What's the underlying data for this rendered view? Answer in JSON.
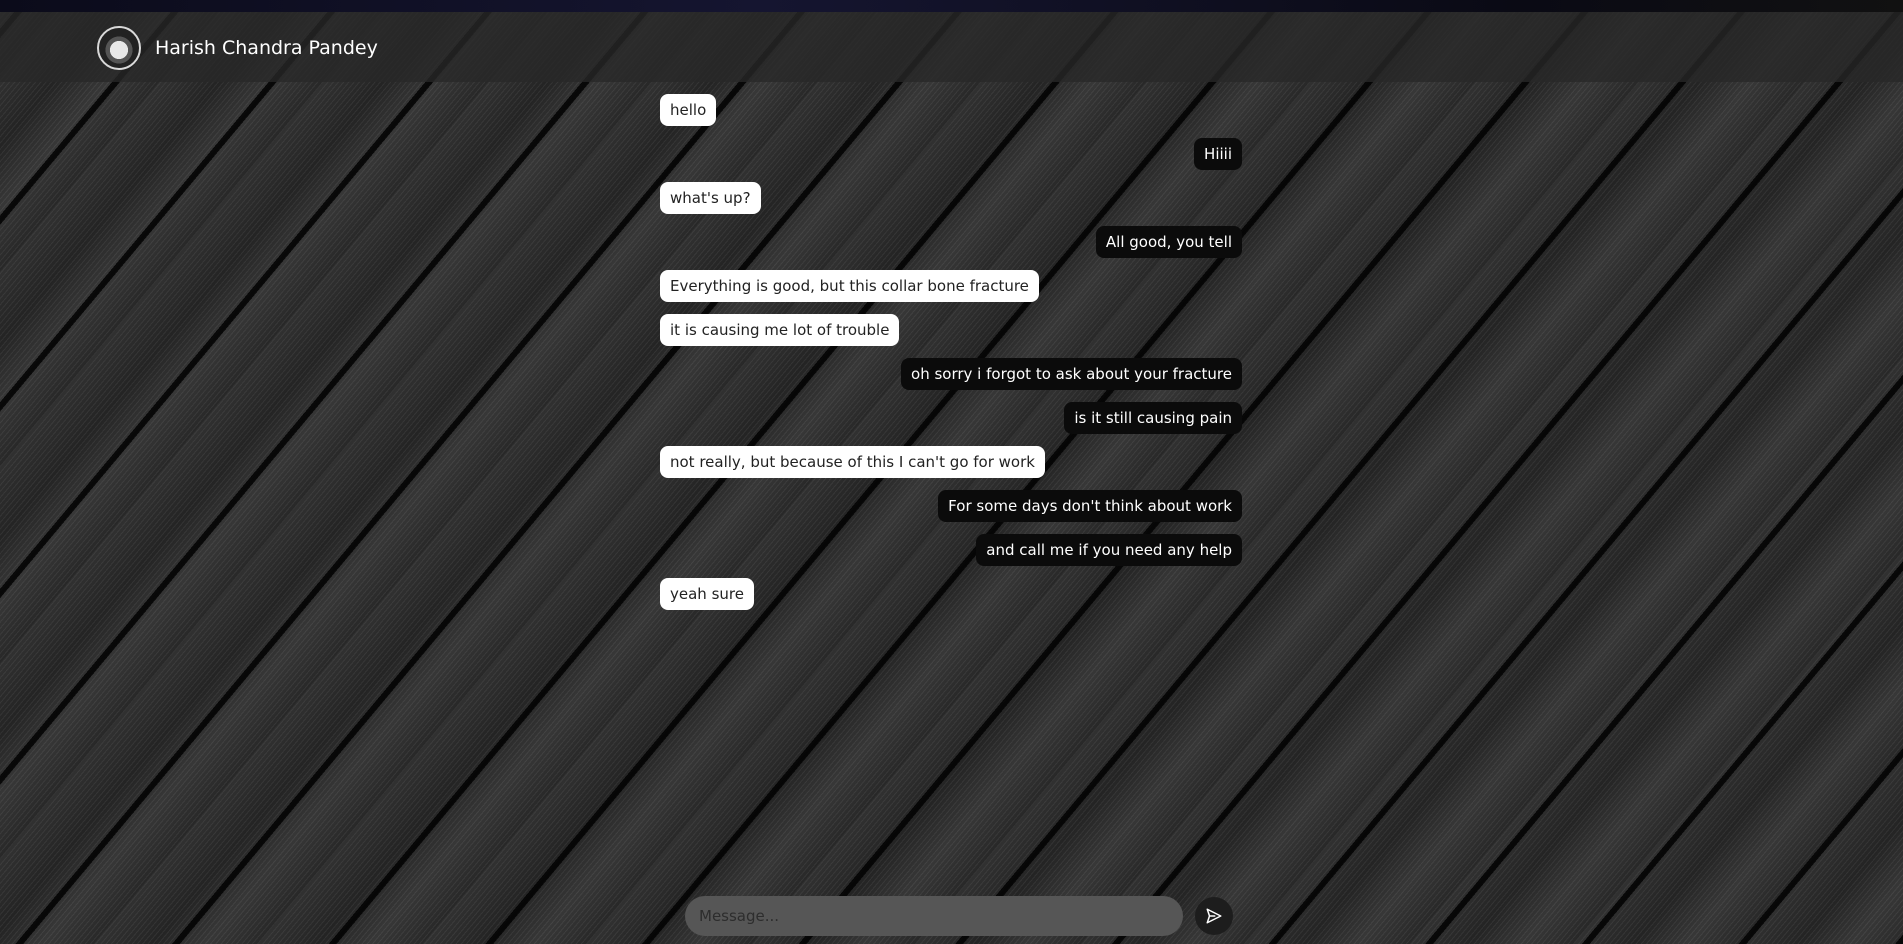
{
  "header": {
    "contact_name": "Harish Chandra Pandey"
  },
  "messages": [
    {
      "text": "hello",
      "direction": "received"
    },
    {
      "text": "Hiiii",
      "direction": "sent"
    },
    {
      "text": "what's up?",
      "direction": "received"
    },
    {
      "text": "All good, you tell",
      "direction": "sent"
    },
    {
      "text": "Everything is good, but this collar bone fracture",
      "direction": "received"
    },
    {
      "text": "it is causing me lot of trouble",
      "direction": "received"
    },
    {
      "text": "oh sorry i forgot to ask about your fracture",
      "direction": "sent"
    },
    {
      "text": "is it still causing pain",
      "direction": "sent"
    },
    {
      "text": "not really, but because of this I can't go for work",
      "direction": "received"
    },
    {
      "text": "For some days don't think about work",
      "direction": "sent"
    },
    {
      "text": "and call me if you need any help",
      "direction": "sent"
    },
    {
      "text": "yeah sure",
      "direction": "received"
    }
  ],
  "composer": {
    "placeholder": "Message...",
    "value": ""
  },
  "icons": {
    "send": "send-icon",
    "avatar": "avatar"
  },
  "colors": {
    "sent_bubble": "#0b0b0b",
    "received_bubble": "#ffffff",
    "header_bg": "#282828"
  }
}
